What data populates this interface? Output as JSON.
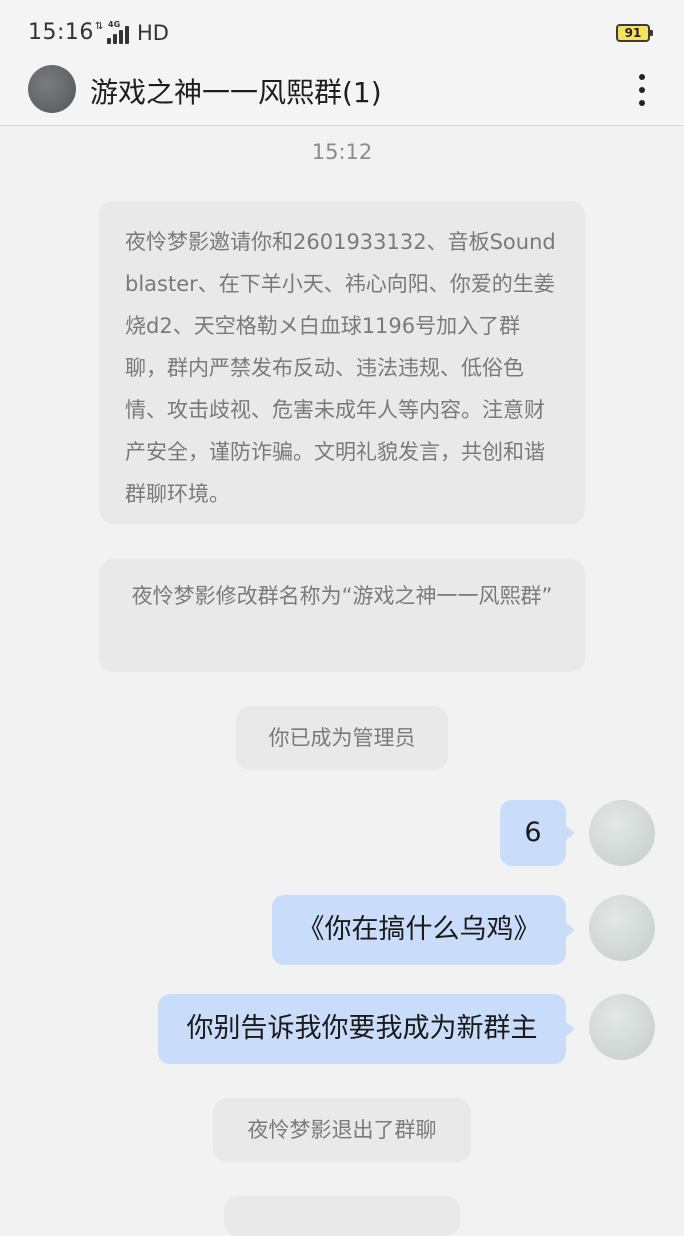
{
  "status_bar": {
    "time": "15:16",
    "network": "4G",
    "hd": "HD",
    "battery": "91",
    "battery_color": "#f5e25a"
  },
  "header": {
    "title": "游戏之神一一风熙群(1)",
    "avatar_icon": "group-avatar",
    "menu_icon": "more-vertical-icon"
  },
  "messages": {
    "timestamp": "15:12",
    "system": [
      "夜怜梦影邀请你和2601933132、音板Soundblaster、在下羊小天、祎心向阳、你爱的生姜烧d2、天空格勒メ白血球1196号加入了群聊，群内严禁发布反动、违法违规、低俗色情、攻击歧视、危害未成年人等内容。注意财产安全，谨防诈骗。文明礼貌发言，共创和谐群聊环境。",
      "夜怜梦影修改群名称为“游戏之神一一风熙群”",
      "你已成为管理员",
      "夜怜梦影退出了群聊"
    ],
    "sent": [
      "6",
      "《你在搞什么乌鸡》",
      "你别告诉我你要我成为新群主"
    ],
    "bubble_color": "#c9ddfb"
  }
}
